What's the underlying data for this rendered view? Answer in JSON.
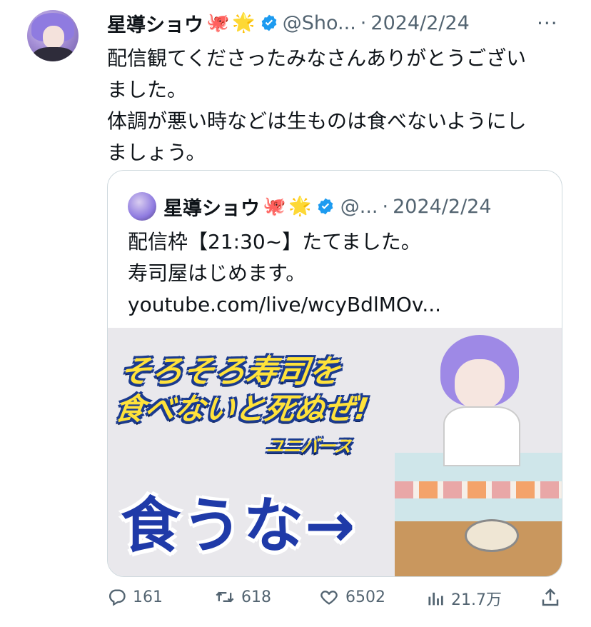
{
  "author": {
    "name": "星導ショウ",
    "emojis": [
      "🐙",
      "🌟"
    ],
    "handle": "@Sho...",
    "date": "2024/2/24"
  },
  "tweet": {
    "lines": [
      "配信観てくださったみなさんありがとうござい",
      "ました。",
      "体調が悪い時などは生ものは食べないようにし",
      "ましょう。"
    ]
  },
  "quote": {
    "name": "星導ショウ",
    "emojis": [
      "🐙",
      "🌟"
    ],
    "handle": "@...",
    "date": "2024/2/24",
    "lines": [
      "配信枠【21:30~】たてました。",
      "寿司屋はじめます。",
      "youtube.com/live/wcyBdlMOv..."
    ],
    "thumbnail": {
      "title_line1": "そろそろ寿司を",
      "title_line2": "食べないと死ぬぜ!",
      "title_sub": "ユニバース",
      "caption": "食うな→"
    }
  },
  "actions": {
    "replies": "161",
    "retweets": "618",
    "likes": "6502",
    "views": "21.7万"
  },
  "colors": {
    "verified": "#1d9bf0",
    "muted": "#536471",
    "border": "#cfd9de"
  },
  "icons": {
    "more": "more-horizontal-icon",
    "verified": "verified-badge-icon",
    "reply": "reply-icon",
    "retweet": "retweet-icon",
    "like": "heart-icon",
    "views": "views-icon",
    "share": "share-icon"
  }
}
